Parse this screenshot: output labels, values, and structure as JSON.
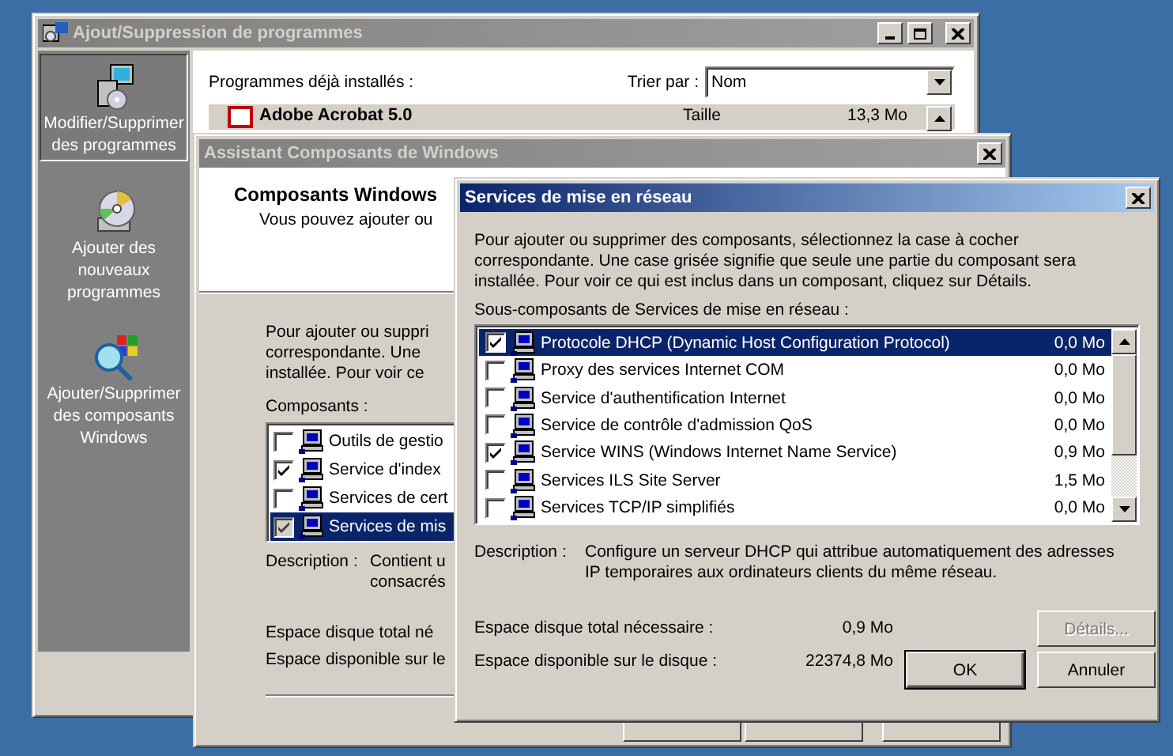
{
  "programs_window": {
    "title": "Ajout/Suppression de programmes",
    "active": false,
    "sidebar": [
      {
        "label": "Modifier/Supprimer des programmes",
        "selected": true,
        "kind": "programs"
      },
      {
        "label": "Ajouter des nouveaux programmes",
        "selected": false,
        "kind": "cd"
      },
      {
        "label": "Ajouter/Supprimer des composants Windows",
        "selected": false,
        "kind": "components"
      }
    ],
    "installed_label": "Programmes déjà installés :",
    "sort_label": "Trier par :",
    "sort_value": "Nom",
    "programs": [
      {
        "name": "Adobe Acrobat 5.0",
        "size_label": "Taille",
        "size": "13,3 Mo"
      }
    ]
  },
  "wizard_window": {
    "title": "Assistant Composants de Windows",
    "active": false,
    "header_title": "Composants Windows",
    "header_subtitle": "Vous pouvez ajouter ou",
    "intro_lines": [
      "Pour ajouter ou suppri",
      "correspondante. Une",
      "installée. Pour voir ce"
    ],
    "components_label": "Composants :",
    "components": [
      {
        "label": "Outils de gestio",
        "checked": false,
        "selected": false
      },
      {
        "label": "Service d'index",
        "checked": true,
        "selected": false
      },
      {
        "label": "Services de cert",
        "checked": false,
        "selected": false
      },
      {
        "label": "Services de mis",
        "checked": true,
        "selected": true
      }
    ],
    "description_label": "Description :",
    "description_lines": [
      "Contient u",
      "consacrés"
    ],
    "disk_total_label": "Espace disque total né",
    "disk_free_label": "Espace disponible sur le"
  },
  "dialog": {
    "title": "Services de mise en réseau",
    "active": true,
    "intro": "Pour ajouter ou supprimer des composants, sélectionnez la case à cocher correspondante. Une case grisée signifie que seule une partie du composant sera installée. Pour voir ce qui est inclus dans un composant, cliquez sur Détails.",
    "subcomponents_label": "Sous-composants de Services de mise en réseau :",
    "items": [
      {
        "label": "Protocole DHCP (Dynamic Host Configuration Protocol)",
        "size": "0,0 Mo",
        "checked": true,
        "selected": true
      },
      {
        "label": "Proxy des services Internet COM",
        "size": "0,0 Mo",
        "checked": false,
        "selected": false
      },
      {
        "label": "Service d'authentification Internet",
        "size": "0,0 Mo",
        "checked": false,
        "selected": false
      },
      {
        "label": "Service de contrôle d'admission QoS",
        "size": "0,0 Mo",
        "checked": false,
        "selected": false
      },
      {
        "label": "Service WINS (Windows Internet Name Service)",
        "size": "0,9 Mo",
        "checked": true,
        "selected": false
      },
      {
        "label": "Services ILS Site Server",
        "size": "1,5 Mo",
        "checked": false,
        "selected": false
      },
      {
        "label": "Services TCP/IP simplifiés",
        "size": "0,0 Mo",
        "checked": false,
        "selected": false
      }
    ],
    "description_label": "Description :",
    "description": "Configure un serveur DHCP qui attribue automatiquement des adresses IP temporaires aux ordinateurs clients du même réseau.",
    "disk_total_label": "Espace disque total nécessaire :",
    "disk_total": "0,9 Mo",
    "disk_free_label": "Espace disponible sur le disque :",
    "disk_free": "22374,8 Mo",
    "buttons": [
      {
        "label": "Détails...",
        "disabled": true,
        "default": false
      },
      {
        "label": "OK",
        "disabled": false,
        "default": true
      },
      {
        "label": "Annuler",
        "disabled": false,
        "default": false
      }
    ]
  }
}
